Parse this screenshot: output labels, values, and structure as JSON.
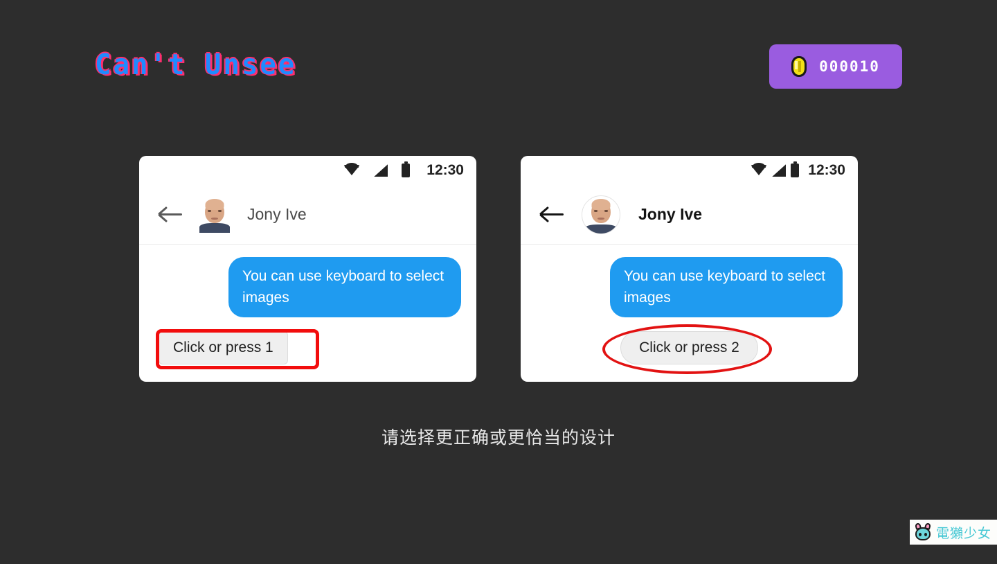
{
  "app": {
    "title": "Can't Unsee",
    "background_color": "#2d2d2d"
  },
  "score": {
    "coin_icon": "coin-icon",
    "value": "000010",
    "badge_color": "#9a5ce0"
  },
  "prompt": {
    "text": "请选择更正确或更恰当的设计"
  },
  "options": [
    {
      "id": 1,
      "status_bar": {
        "wifi_icon": "wifi-icon",
        "signal_icon": "signal-icon",
        "battery_icon": "battery-icon",
        "time": "12:30"
      },
      "app_bar": {
        "back_icon": "back-arrow-icon",
        "avatar_icon": "avatar",
        "contact_name": "Jony Ive"
      },
      "message": {
        "text": "You can use keyboard to select images",
        "bubble_color": "#1f9bf0",
        "text_color": "#ffffff"
      },
      "choose_button": "Click or press 1",
      "annotation_shape": "rectangle",
      "annotation_color": "#f20d0d"
    },
    {
      "id": 2,
      "status_bar": {
        "wifi_icon": "wifi-icon",
        "signal_icon": "signal-icon",
        "battery_icon": "battery-icon",
        "time": "12:30"
      },
      "app_bar": {
        "back_icon": "back-arrow-icon",
        "avatar_icon": "avatar",
        "contact_name": "Jony Ive"
      },
      "message": {
        "text": "You can use keyboard to select images",
        "bubble_color": "#1f9bf0",
        "text_color": "#ffffff"
      },
      "choose_button": "Click or press 2",
      "annotation_shape": "ellipse",
      "annotation_color": "#e21212"
    }
  ],
  "watermark": {
    "mascot_icon": "otter-girl-mascot-icon",
    "text": "電獺少女",
    "text_color": "#47c8d4"
  }
}
